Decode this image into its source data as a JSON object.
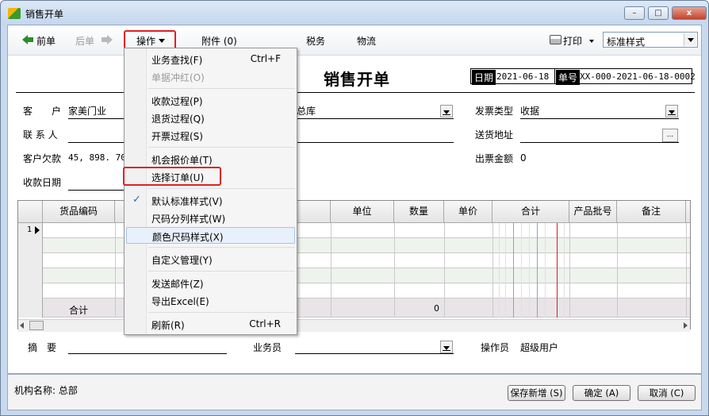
{
  "window": {
    "title": "销售开单",
    "controls": {
      "minimize": "–",
      "maximize": "□",
      "close": "x"
    }
  },
  "toolbar": {
    "prev": "前单",
    "next": "后单",
    "operate": "操作",
    "attachments": "附件 (0)",
    "tax": "税务",
    "logistics": "物流",
    "print": "打印",
    "style_value": "标准样式"
  },
  "doc": {
    "title": "销售开单",
    "date_label": "日期",
    "date_value": "2021-06-18",
    "no_label": "单号",
    "no_value": "XX-000-2021-06-18-0002"
  },
  "form": {
    "customer_label": "客　　户",
    "customer_value": "家美门业",
    "contact_label": "联 系 人",
    "debt_label": "客户欠款",
    "debt_value": "45, 898. 70",
    "collect_date_label": "收款日期",
    "warehouse_value": "总库",
    "invoice_type_label": "发票类型",
    "invoice_type_value": "收据",
    "ship_addr_label": "送货地址",
    "ship_addr_btn": "...",
    "invoice_amount_label": "出票金额",
    "invoice_amount_value": "0",
    "summary_label": "摘　要",
    "salesperson_label": "业务员",
    "operator_label": "操作员",
    "operator_value": "超级用户"
  },
  "grid": {
    "headers": [
      "货品编码",
      "单位",
      "数量",
      "单价",
      "合计",
      "产品批号",
      "备注"
    ],
    "first_row_num": "1",
    "total_label": "合计",
    "total_qty": "0"
  },
  "menu": {
    "items": [
      {
        "label": "业务查找(F)",
        "shortcut": "Ctrl+F"
      },
      {
        "label": "单据冲红(O)",
        "disabled": true
      },
      {
        "label": "收款过程(P)"
      },
      {
        "label": "退货过程(Q)"
      },
      {
        "label": "开票过程(S)"
      },
      {
        "label": "机会报价单(T)"
      },
      {
        "label": "选择订单(U)"
      },
      {
        "label": "默认标准样式(V)",
        "checked": true
      },
      {
        "label": "尺码分列样式(W)"
      },
      {
        "label": "颜色尺码样式(X)"
      },
      {
        "label": "自定义管理(Y)"
      },
      {
        "label": "发送邮件(Z)"
      },
      {
        "label": "导出Excel(E)"
      },
      {
        "label": "刷新(R)",
        "shortcut": "Ctrl+R"
      }
    ],
    "check_glyph": "✓"
  },
  "footer": {
    "org_label": "机构名称: 总部",
    "save_new": "保存新增 (S)",
    "ok": "确定 (A)",
    "cancel": "取消 (C)"
  },
  "colors": {
    "highlight_box": "#e02020",
    "window_frame": "#c9d9ed"
  }
}
